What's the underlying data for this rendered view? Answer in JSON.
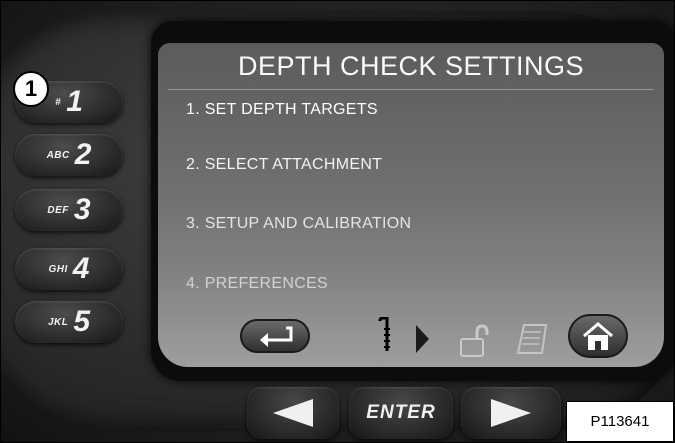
{
  "screen": {
    "title": "DEPTH CHECK SETTINGS",
    "menu_items": [
      {
        "label": "1. SET DEPTH TARGETS",
        "color": "#ffffff"
      },
      {
        "label": "2. SELECT ATTACHMENT",
        "color": "#f2f2f2"
      },
      {
        "label": "3. SETUP AND CALIBRATION",
        "color": "#e4e4e4"
      },
      {
        "label": "4. PREFERENCES",
        "color": "#cfcfcf"
      }
    ]
  },
  "keypad": [
    {
      "letters": "#",
      "digit": "1"
    },
    {
      "letters": "ABC",
      "digit": "2"
    },
    {
      "letters": "DEF",
      "digit": "3"
    },
    {
      "letters": "GHI",
      "digit": "4"
    },
    {
      "letters": "JKL",
      "digit": "5"
    }
  ],
  "navigation": {
    "enter_label": "ENTER"
  },
  "callout_number": "1",
  "reference_label": "P113641",
  "toolbar_icons": [
    "back-icon",
    "probe-icon",
    "chevron-right-icon",
    "unlock-icon",
    "document-icon",
    "home-icon"
  ]
}
